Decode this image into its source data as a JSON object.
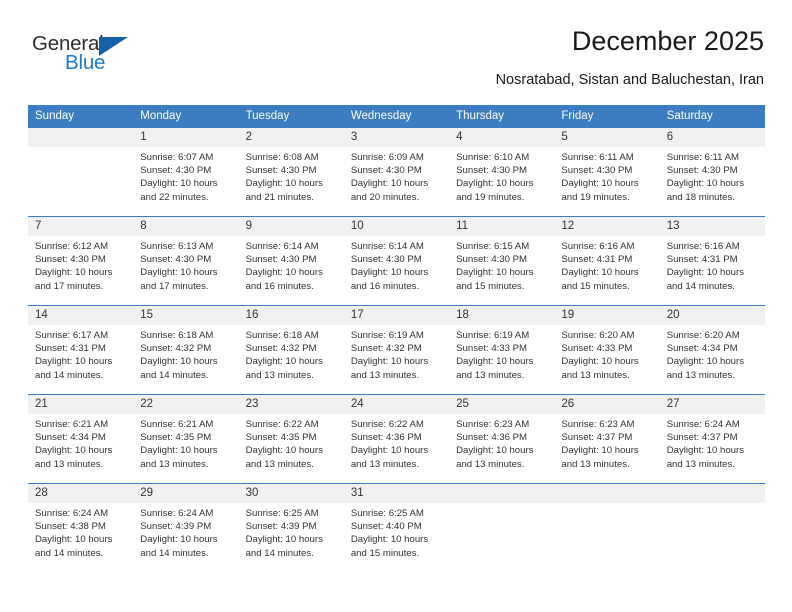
{
  "brand": {
    "name_top": "General",
    "name_bottom": "Blue",
    "accent_color": "#1560a8",
    "text_color": "#2e2e2e"
  },
  "header": {
    "title": "December 2025",
    "subtitle": "Nosratabad, Sistan and Baluchestan, Iran"
  },
  "calendar": {
    "header_color": "#3b7dc0",
    "daynum_background": "#f1f1f1",
    "weekdays": [
      "Sunday",
      "Monday",
      "Tuesday",
      "Wednesday",
      "Thursday",
      "Friday",
      "Saturday"
    ],
    "weeks": [
      [
        {
          "day": "",
          "sunrise": "",
          "sunset": "",
          "daylight": ""
        },
        {
          "day": "1",
          "sunrise": "Sunrise: 6:07 AM",
          "sunset": "Sunset: 4:30 PM",
          "daylight": "Daylight: 10 hours and 22 minutes."
        },
        {
          "day": "2",
          "sunrise": "Sunrise: 6:08 AM",
          "sunset": "Sunset: 4:30 PM",
          "daylight": "Daylight: 10 hours and 21 minutes."
        },
        {
          "day": "3",
          "sunrise": "Sunrise: 6:09 AM",
          "sunset": "Sunset: 4:30 PM",
          "daylight": "Daylight: 10 hours and 20 minutes."
        },
        {
          "day": "4",
          "sunrise": "Sunrise: 6:10 AM",
          "sunset": "Sunset: 4:30 PM",
          "daylight": "Daylight: 10 hours and 19 minutes."
        },
        {
          "day": "5",
          "sunrise": "Sunrise: 6:11 AM",
          "sunset": "Sunset: 4:30 PM",
          "daylight": "Daylight: 10 hours and 19 minutes."
        },
        {
          "day": "6",
          "sunrise": "Sunrise: 6:11 AM",
          "sunset": "Sunset: 4:30 PM",
          "daylight": "Daylight: 10 hours and 18 minutes."
        }
      ],
      [
        {
          "day": "7",
          "sunrise": "Sunrise: 6:12 AM",
          "sunset": "Sunset: 4:30 PM",
          "daylight": "Daylight: 10 hours and 17 minutes."
        },
        {
          "day": "8",
          "sunrise": "Sunrise: 6:13 AM",
          "sunset": "Sunset: 4:30 PM",
          "daylight": "Daylight: 10 hours and 17 minutes."
        },
        {
          "day": "9",
          "sunrise": "Sunrise: 6:14 AM",
          "sunset": "Sunset: 4:30 PM",
          "daylight": "Daylight: 10 hours and 16 minutes."
        },
        {
          "day": "10",
          "sunrise": "Sunrise: 6:14 AM",
          "sunset": "Sunset: 4:30 PM",
          "daylight": "Daylight: 10 hours and 16 minutes."
        },
        {
          "day": "11",
          "sunrise": "Sunrise: 6:15 AM",
          "sunset": "Sunset: 4:30 PM",
          "daylight": "Daylight: 10 hours and 15 minutes."
        },
        {
          "day": "12",
          "sunrise": "Sunrise: 6:16 AM",
          "sunset": "Sunset: 4:31 PM",
          "daylight": "Daylight: 10 hours and 15 minutes."
        },
        {
          "day": "13",
          "sunrise": "Sunrise: 6:16 AM",
          "sunset": "Sunset: 4:31 PM",
          "daylight": "Daylight: 10 hours and 14 minutes."
        }
      ],
      [
        {
          "day": "14",
          "sunrise": "Sunrise: 6:17 AM",
          "sunset": "Sunset: 4:31 PM",
          "daylight": "Daylight: 10 hours and 14 minutes."
        },
        {
          "day": "15",
          "sunrise": "Sunrise: 6:18 AM",
          "sunset": "Sunset: 4:32 PM",
          "daylight": "Daylight: 10 hours and 14 minutes."
        },
        {
          "day": "16",
          "sunrise": "Sunrise: 6:18 AM",
          "sunset": "Sunset: 4:32 PM",
          "daylight": "Daylight: 10 hours and 13 minutes."
        },
        {
          "day": "17",
          "sunrise": "Sunrise: 6:19 AM",
          "sunset": "Sunset: 4:32 PM",
          "daylight": "Daylight: 10 hours and 13 minutes."
        },
        {
          "day": "18",
          "sunrise": "Sunrise: 6:19 AM",
          "sunset": "Sunset: 4:33 PM",
          "daylight": "Daylight: 10 hours and 13 minutes."
        },
        {
          "day": "19",
          "sunrise": "Sunrise: 6:20 AM",
          "sunset": "Sunset: 4:33 PM",
          "daylight": "Daylight: 10 hours and 13 minutes."
        },
        {
          "day": "20",
          "sunrise": "Sunrise: 6:20 AM",
          "sunset": "Sunset: 4:34 PM",
          "daylight": "Daylight: 10 hours and 13 minutes."
        }
      ],
      [
        {
          "day": "21",
          "sunrise": "Sunrise: 6:21 AM",
          "sunset": "Sunset: 4:34 PM",
          "daylight": "Daylight: 10 hours and 13 minutes."
        },
        {
          "day": "22",
          "sunrise": "Sunrise: 6:21 AM",
          "sunset": "Sunset: 4:35 PM",
          "daylight": "Daylight: 10 hours and 13 minutes."
        },
        {
          "day": "23",
          "sunrise": "Sunrise: 6:22 AM",
          "sunset": "Sunset: 4:35 PM",
          "daylight": "Daylight: 10 hours and 13 minutes."
        },
        {
          "day": "24",
          "sunrise": "Sunrise: 6:22 AM",
          "sunset": "Sunset: 4:36 PM",
          "daylight": "Daylight: 10 hours and 13 minutes."
        },
        {
          "day": "25",
          "sunrise": "Sunrise: 6:23 AM",
          "sunset": "Sunset: 4:36 PM",
          "daylight": "Daylight: 10 hours and 13 minutes."
        },
        {
          "day": "26",
          "sunrise": "Sunrise: 6:23 AM",
          "sunset": "Sunset: 4:37 PM",
          "daylight": "Daylight: 10 hours and 13 minutes."
        },
        {
          "day": "27",
          "sunrise": "Sunrise: 6:24 AM",
          "sunset": "Sunset: 4:37 PM",
          "daylight": "Daylight: 10 hours and 13 minutes."
        }
      ],
      [
        {
          "day": "28",
          "sunrise": "Sunrise: 6:24 AM",
          "sunset": "Sunset: 4:38 PM",
          "daylight": "Daylight: 10 hours and 14 minutes."
        },
        {
          "day": "29",
          "sunrise": "Sunrise: 6:24 AM",
          "sunset": "Sunset: 4:39 PM",
          "daylight": "Daylight: 10 hours and 14 minutes."
        },
        {
          "day": "30",
          "sunrise": "Sunrise: 6:25 AM",
          "sunset": "Sunset: 4:39 PM",
          "daylight": "Daylight: 10 hours and 14 minutes."
        },
        {
          "day": "31",
          "sunrise": "Sunrise: 6:25 AM",
          "sunset": "Sunset: 4:40 PM",
          "daylight": "Daylight: 10 hours and 15 minutes."
        },
        {
          "day": "",
          "sunrise": "",
          "sunset": "",
          "daylight": ""
        },
        {
          "day": "",
          "sunrise": "",
          "sunset": "",
          "daylight": ""
        },
        {
          "day": "",
          "sunrise": "",
          "sunset": "",
          "daylight": ""
        }
      ]
    ]
  }
}
